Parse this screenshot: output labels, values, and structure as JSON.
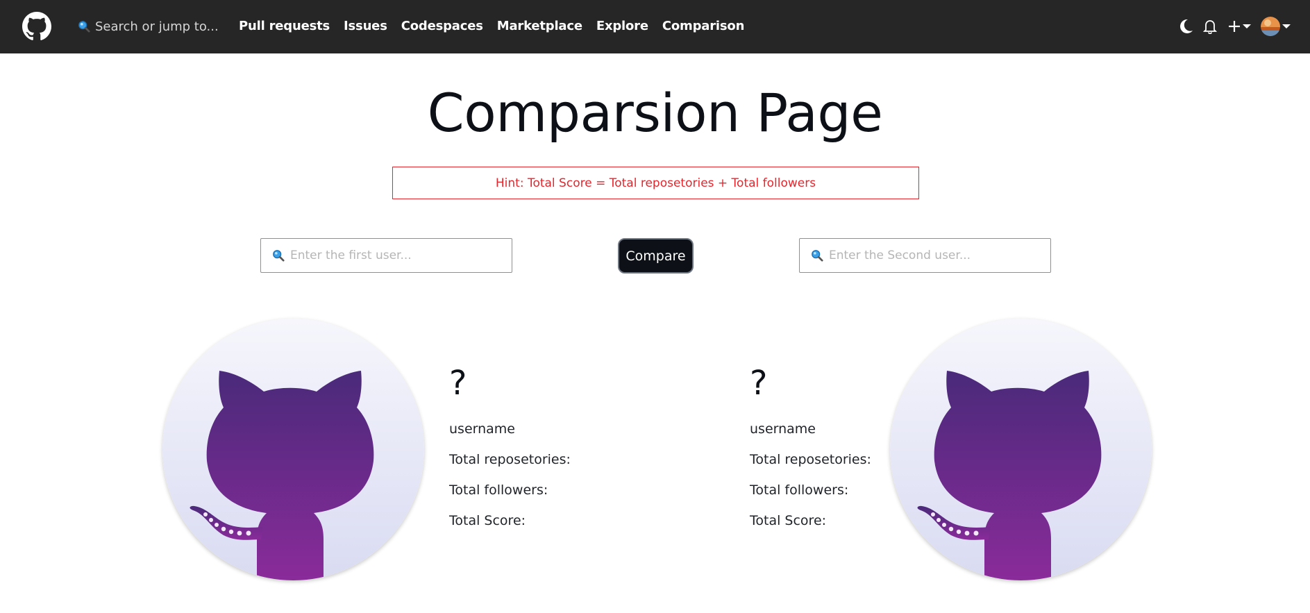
{
  "header": {
    "search_placeholder": "Search or jump to...",
    "nav": [
      {
        "label": "Pull requests"
      },
      {
        "label": "Issues"
      },
      {
        "label": "Codespaces"
      },
      {
        "label": "Marketplace"
      },
      {
        "label": "Explore"
      },
      {
        "label": "Comparison"
      }
    ],
    "icons": [
      "github-logo",
      "search-icon",
      "moon-icon",
      "bell-icon",
      "plus-icon",
      "avatar"
    ]
  },
  "main": {
    "title": "Comparsion Page",
    "hint": "Hint: Total Score = Total reposetories + Total followers",
    "first_user_placeholder": "Enter the first user...",
    "second_user_placeholder": "Enter the Second user...",
    "compare_label": "Compare",
    "user1": {
      "name": "?",
      "username": "username",
      "repos_label": "Total reposetories:",
      "followers_label": "Total followers:",
      "score_label": "Total Score:"
    },
    "user2": {
      "name": "?",
      "username": "username",
      "repos_label": "Total reposetories:",
      "followers_label": "Total followers:",
      "score_label": "Total Score:"
    }
  },
  "colors": {
    "header_bg": "#262626",
    "hint_red": "#e6262d",
    "button_bg": "#0d1117",
    "octocat_purple_top": "#4a2a7a",
    "octocat_purple_bottom": "#8a2b9a"
  }
}
